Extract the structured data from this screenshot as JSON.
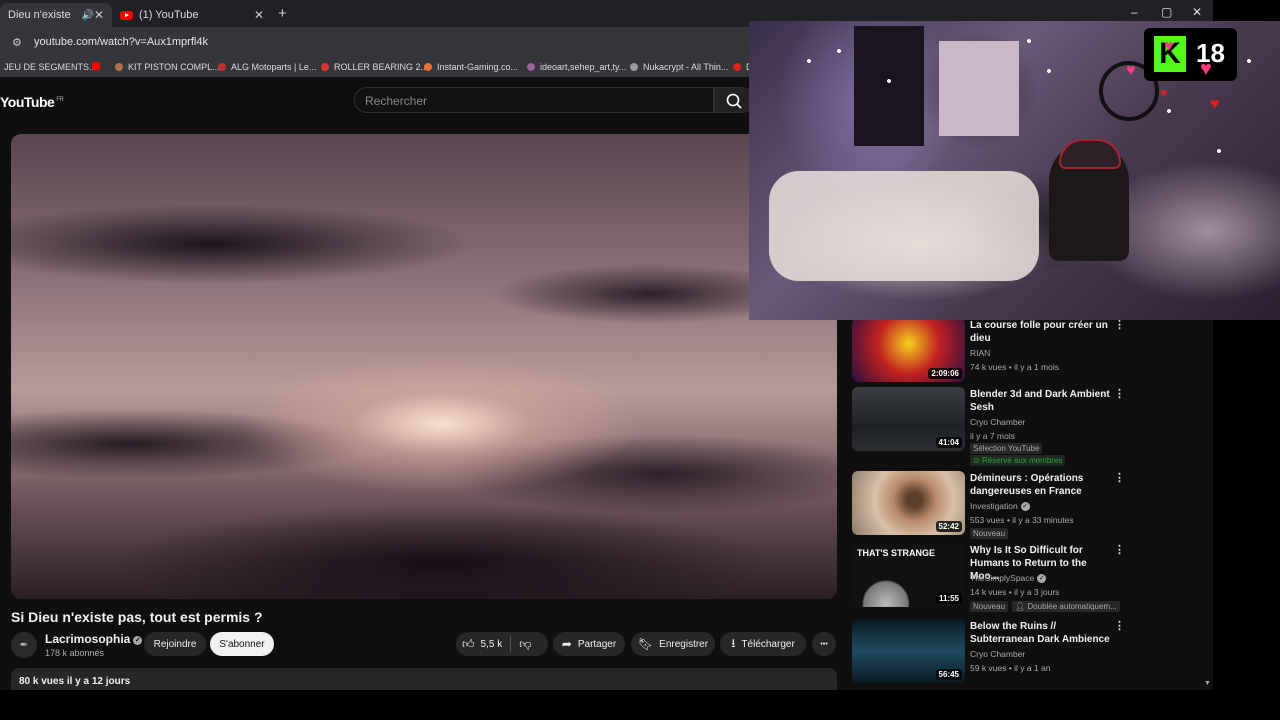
{
  "browser": {
    "tabs": [
      {
        "title": "Dieu n'existe pas, tout",
        "active": true
      },
      {
        "title": "(1) YouTube",
        "active": false
      }
    ],
    "new_tab": "+",
    "window_controls": {
      "minimize": "–",
      "maximize": "▢",
      "close": "✕"
    },
    "url": "youtube.com/watch?v=Aux1mprfl4k",
    "bookmarks": [
      {
        "label": "JEU DE SEGMENTS...",
        "color": "#888888"
      },
      {
        "label": "",
        "color": "#ff0000"
      },
      {
        "label": "KIT PISTON COMPL...",
        "color": "#b07050"
      },
      {
        "label": "ALG Motoparts | Le...",
        "color": "#c03030"
      },
      {
        "label": "ROLLER BEARING 2...",
        "color": "#e03030"
      },
      {
        "label": "Instant-Gaming.co...",
        "color": "#f07030"
      },
      {
        "label": "ideoart,sehep_art,ty...",
        "color": "#a060a0"
      },
      {
        "label": "Nukacrypt - All Thin...",
        "color": "#999999"
      },
      {
        "label": "D",
        "color": "#e02020"
      }
    ]
  },
  "youtube": {
    "logo": "YouTube",
    "logo_region": "FR",
    "search_placeholder": "Rechercher",
    "video": {
      "title": "Si Dieu n'existe pas, tout est permis ?",
      "channel": "Lacrimosophia",
      "subscribers": "178 k abonnés",
      "join": "Rejoindre",
      "subscribe": "S'abonner",
      "likes": "5,5 k",
      "share": "Partager",
      "save": "Enregistrer",
      "download": "Télécharger",
      "more": "•••",
      "views_date": "80 k vues  il y a 12 jours"
    },
    "recommendations": [
      {
        "title": "La course folle pour créer un dieu",
        "channel": "RIAN",
        "meta": "74 k vues • il y a 1 mois",
        "duration": "2:09:06",
        "thumb_color": "#e0b020"
      },
      {
        "title": "Blender 3d and Dark Ambient Sesh",
        "channel": "Cryo Chamber",
        "meta": "il y a 7 mois",
        "duration": "41:04",
        "badge": "Sélection YouTube",
        "members": "Réservé aux membres",
        "thumb_color": "#2a2e33"
      },
      {
        "title": "Démineurs : Opérations dangereuses en France",
        "channel": "Investigation",
        "meta": "553 vues • il y a 33 minutes",
        "duration": "52:42",
        "badge": "Nouveau",
        "thumb_color": "#9a7a60"
      },
      {
        "title": "Why Is It So Difficult for Humans to Return to the Moo...",
        "channel": "TheSimplySpace",
        "meta": "14 k vues • il y a 3 jours",
        "duration": "11:55",
        "badge": "Nouveau",
        "badge2": "Doublée automatiquem...",
        "thumb_text": "THAT'S STRANGE",
        "thumb_color": "#111111"
      },
      {
        "title": "Below the Ruins // Subterranean Dark Ambience",
        "channel": "Cryo Chamber",
        "meta": "59 k vues • il y a 1 an",
        "duration": "56:45",
        "thumb_color": "#0e2a3a"
      }
    ]
  },
  "overlay": {
    "kick_logo": "K",
    "viewer_count": "18"
  }
}
